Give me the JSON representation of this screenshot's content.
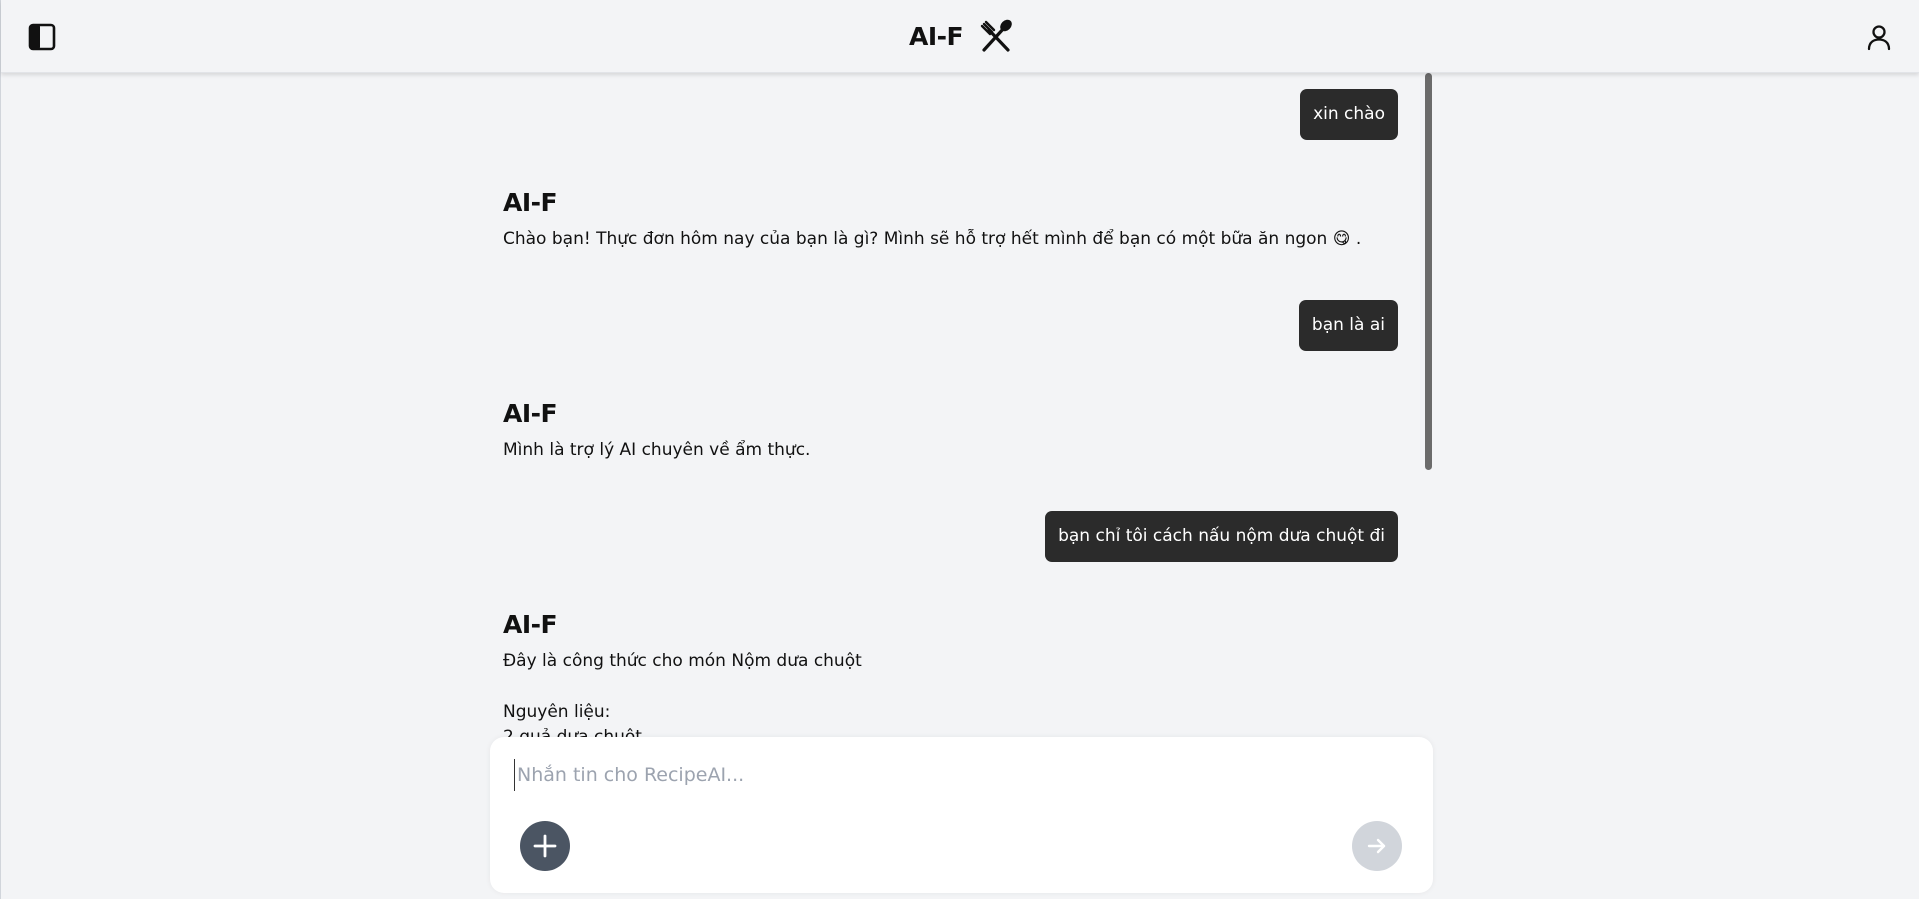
{
  "header": {
    "title": "AI-F",
    "logo_icon": "fork-spoon-icon",
    "sidebar_toggle_icon": "sidebar-panel-icon",
    "user_icon": "user-icon"
  },
  "chat": {
    "messages": [
      {
        "role": "user",
        "text": "xin chào"
      },
      {
        "role": "assistant",
        "name": "AI-F",
        "text": "Chào bạn! Thực đơn hôm nay của bạn là gì? Mình sẽ hỗ trợ hết mình để bạn có một bữa ăn ngon 😋 ."
      },
      {
        "role": "user",
        "text": "bạn là ai"
      },
      {
        "role": "assistant",
        "name": "AI-F",
        "text": "Mình là trợ lý AI chuyên về ẩm thực."
      },
      {
        "role": "user",
        "text": "bạn chỉ tôi cách nấu nộm dưa chuột đi"
      },
      {
        "role": "assistant",
        "name": "AI-F",
        "lines": [
          "Đây là công thức cho món Nộm dưa chuột",
          "Nguyên liệu:",
          "2 quả dưa chuột"
        ]
      }
    ]
  },
  "composer": {
    "placeholder": "Nhắn tin cho RecipeAI...",
    "value": "",
    "add_icon": "plus-icon",
    "send_icon": "arrow-right-icon"
  },
  "colors": {
    "background": "#f3f4f6",
    "user_bubble": "#2b2b2b",
    "add_button": "#4b5563",
    "send_button_disabled": "#d1d5db"
  }
}
